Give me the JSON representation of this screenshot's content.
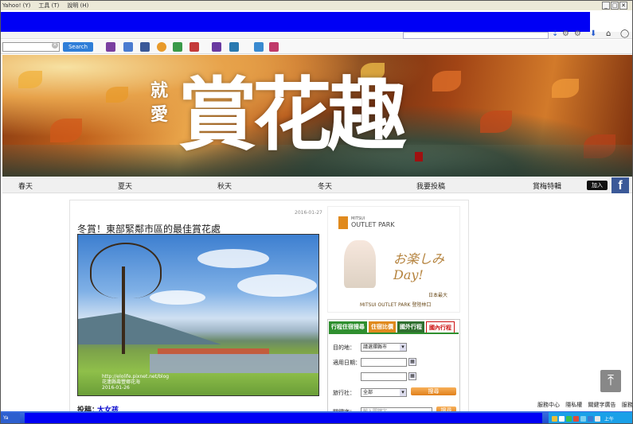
{
  "menubar": {
    "items": [
      "Yahoo! (Y)",
      "工具 (T)",
      "說明 (H)"
    ]
  },
  "toolbar": {
    "search_button_label": "Search",
    "search_value": ""
  },
  "banner": {
    "small_text": "就愛",
    "big_text": "賞花趣"
  },
  "nav": {
    "items": [
      "春天",
      "夏天",
      "秋天",
      "冬天",
      "我要投稿",
      "賞梅特輯"
    ],
    "join_label": "加入",
    "fb_label": "f"
  },
  "post": {
    "date": "2016-01-27",
    "title": "冬賞！東部緊鄰市區的最佳賞花處",
    "author_label": "投稿：",
    "author_name": "大女孩",
    "photo_watermark_1": "http://elolife.pixnet.net/blog",
    "photo_watermark_2": "花蓮縣壽豐鄉花海",
    "photo_watermark_3": "2016-01-26"
  },
  "ad": {
    "brand_small": "MITSUI",
    "brand_big": "OUTLET PARK",
    "script_text": "お楽しみDay!",
    "jp_text": "日本最大",
    "en_text": "MITSUI OUTLET PARK 登陸林口"
  },
  "booking": {
    "tabs": [
      "行程住宿搜尋",
      "住宿比價",
      "國外行程",
      "國內行程"
    ],
    "destination_label": "目的地：",
    "destination_value": "請選擇縣市",
    "date_label": "適用日期：",
    "agency_label": "旅行社：",
    "agency_value": "全部",
    "keyword_label": "關鍵字：",
    "keyword_placeholder": "輸入關鍵字",
    "search_label": "搜尋"
  },
  "footer": {
    "links": [
      "服務中心",
      "隱私權",
      "關鍵字廣告",
      "服務條款"
    ]
  },
  "taskbar": {
    "task_label": "Ya",
    "clock": "上午"
  }
}
